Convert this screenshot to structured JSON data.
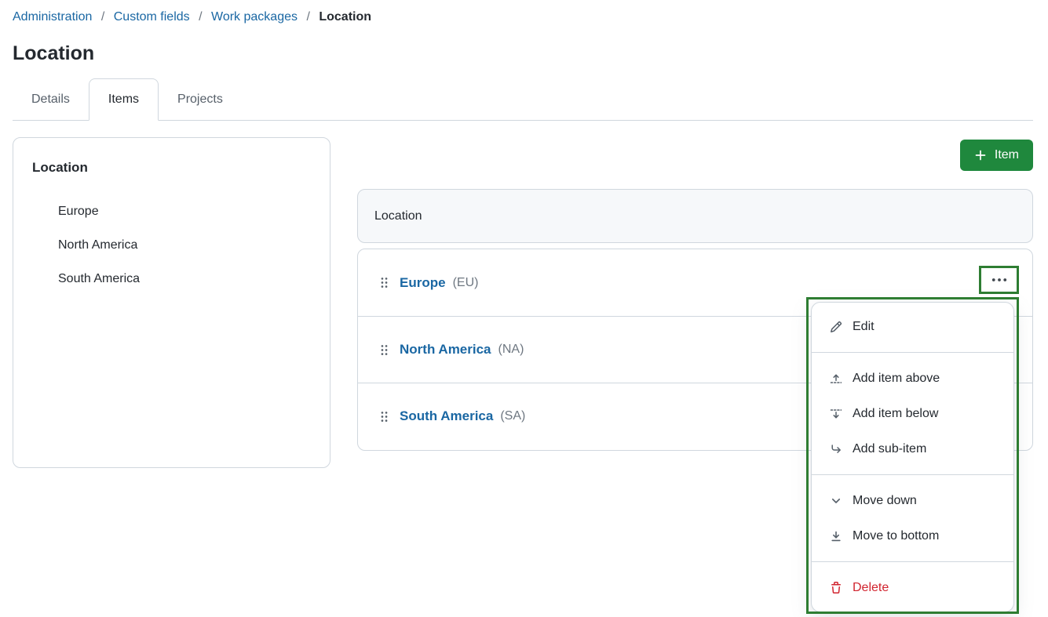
{
  "breadcrumb": {
    "links": [
      "Administration",
      "Custom fields",
      "Work packages"
    ],
    "current": "Location",
    "separator": "/"
  },
  "page": {
    "title": "Location"
  },
  "tabs": {
    "items": [
      "Details",
      "Items",
      "Projects"
    ],
    "active": "Items"
  },
  "preview_card": {
    "title": "Location",
    "items": [
      "Europe",
      "North America",
      "South America"
    ]
  },
  "toolbar": {
    "add_item_label": "Item",
    "plus_icon": "+"
  },
  "table": {
    "header": "Location",
    "rows": [
      {
        "name": "Europe",
        "code": "(EU)"
      },
      {
        "name": "North America",
        "code": "(NA)"
      },
      {
        "name": "South America",
        "code": "(SA)"
      }
    ]
  },
  "context_menu": {
    "groups": [
      {
        "items": [
          {
            "icon": "pencil-icon",
            "label": "Edit"
          }
        ]
      },
      {
        "items": [
          {
            "icon": "fold-up-icon",
            "label": "Add item above"
          },
          {
            "icon": "fold-down-icon",
            "label": "Add item below"
          },
          {
            "icon": "sub-item-arrow-icon",
            "label": "Add sub-item"
          }
        ]
      },
      {
        "items": [
          {
            "icon": "chevron-down-icon",
            "label": "Move down"
          },
          {
            "icon": "move-to-bottom-icon",
            "label": "Move to bottom"
          }
        ]
      },
      {
        "items": [
          {
            "icon": "trash-icon",
            "label": "Delete",
            "danger": true
          }
        ]
      }
    ]
  },
  "icons": {
    "kebab-horizontal-icon": "⋯",
    "drag-grabber-icon": "⠿",
    "plus-icon": "+",
    "pencil-icon": "✎",
    "fold-up-icon": "⇡",
    "fold-down-icon": "⇣",
    "sub-item-arrow-icon": "↳",
    "chevron-down-icon": "⌄",
    "move-to-bottom-icon": "⤓",
    "trash-icon": "🗑"
  },
  "colors": {
    "accent_green": "#1F883D",
    "annotation_green": "#2E7D32",
    "link_blue": "#1A67A3",
    "danger_red": "#D1242F",
    "border_gray": "#D0D7DE",
    "header_bg": "#F6F8FA"
  }
}
